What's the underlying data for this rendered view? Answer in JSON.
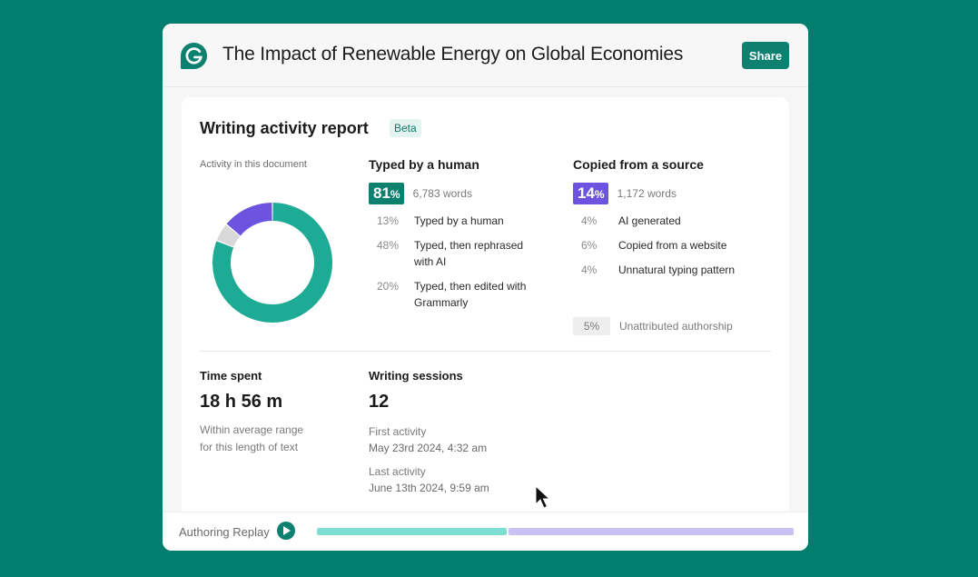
{
  "header": {
    "logo": "grammarly-logo-icon",
    "title": "The Impact of Renewable Energy on Global Economies",
    "share_label": "Share"
  },
  "report": {
    "title": "Writing activity report",
    "badge": "Beta",
    "activity_label": "Activity in this document",
    "donut": {
      "segments": [
        {
          "name": "Typed by a human",
          "percent": 81,
          "color": "#1dab96"
        },
        {
          "name": "Unattributed authorship",
          "percent": 5,
          "color": "#d9d9d9"
        },
        {
          "name": "Copied from a source",
          "percent": 14,
          "color": "#6c54e0"
        }
      ]
    },
    "human": {
      "heading": "Typed by a human",
      "percent": "81",
      "percent_sign": "%",
      "words": "6,783 words",
      "items": [
        {
          "pct": "13%",
          "label": "Typed by a human"
        },
        {
          "pct": "48%",
          "label": "Typed, then rephrased with AI"
        },
        {
          "pct": "20%",
          "label": "Typed, then edited with Grammarly"
        }
      ]
    },
    "copied": {
      "heading": "Copied from a source",
      "percent": "14",
      "percent_sign": "%",
      "words": "1,172 words",
      "items": [
        {
          "pct": "4%",
          "label": "AI generated"
        },
        {
          "pct": "6%",
          "label": "Copied from a website"
        },
        {
          "pct": "4%",
          "label": "Unnatural typing pattern"
        }
      ]
    },
    "unattributed": {
      "pct": "5%",
      "label": "Unattributed authorship"
    },
    "time_spent": {
      "heading": "Time spent",
      "value": "18 h 56 m",
      "note_line1": "Within average range",
      "note_line2": "for this length of text"
    },
    "sessions": {
      "heading": "Writing sessions",
      "value": "12",
      "first_label": "First activity",
      "first_value": "May 23rd 2024, 4:32 am",
      "last_label": "Last activity",
      "last_value": "June 13th 2024, 9:59 am"
    }
  },
  "footer": {
    "replay_label": "Authoring Replay",
    "play_icon": "play-icon",
    "timeline": [
      {
        "name": "typed",
        "fraction": 0.4,
        "color": "#7ddfd2"
      },
      {
        "name": "other",
        "fraction": 0.6,
        "color": "#c9c1f2"
      }
    ]
  }
}
